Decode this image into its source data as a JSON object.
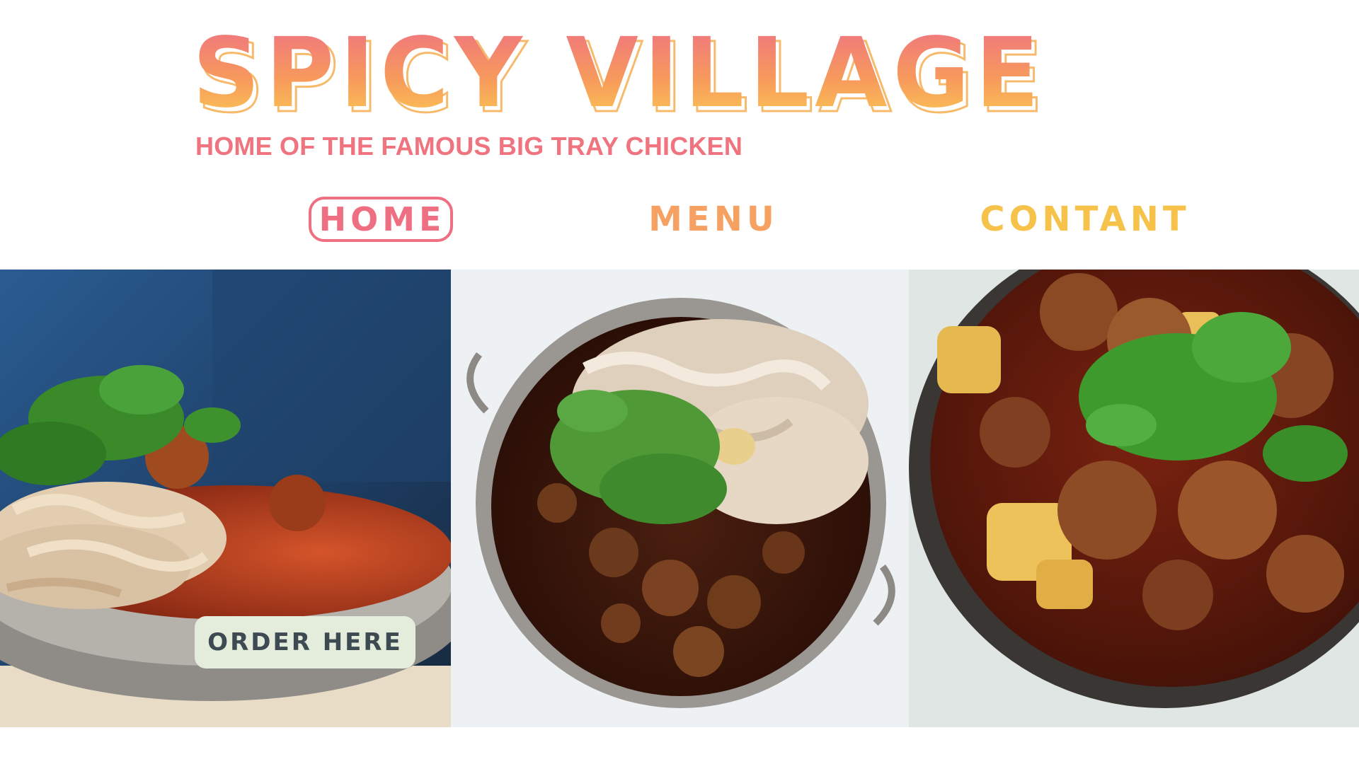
{
  "brand": {
    "name": "SPICY VILLAGE",
    "tagline": "HOME OF THE FAMOUS BIG TRAY CHICKEN",
    "gradient": [
      "#ee6f86",
      "#f79a5c",
      "#fbcf52"
    ]
  },
  "nav": {
    "items": [
      {
        "label": "HOME",
        "active": true
      },
      {
        "label": "MENU",
        "active": false
      },
      {
        "label": "CONTANT",
        "active": false
      }
    ],
    "colors": {
      "home": "#ef6f82",
      "menu": "#f6a062",
      "contant": "#f6c24a"
    }
  },
  "gallery": {
    "order_button": {
      "label": "ORDER HERE",
      "background": "#e4ecdc",
      "text_color": "#3d4a52"
    }
  }
}
